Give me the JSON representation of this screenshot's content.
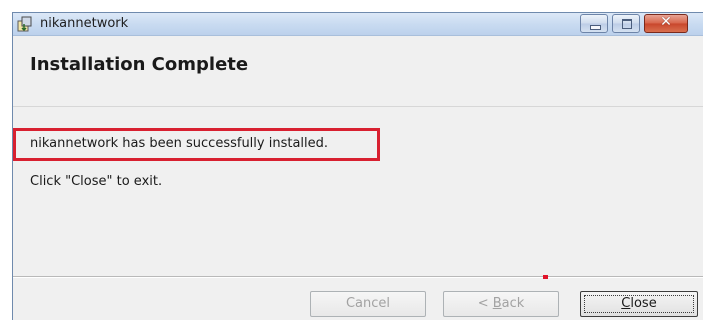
{
  "window": {
    "title": "nikannetwork"
  },
  "titlebar_buttons": {
    "minimize_icon": "minimize-icon",
    "maximize_icon": "maximize-icon",
    "close_icon": "close-icon",
    "close_glyph": "✕"
  },
  "header": {
    "heading": "Installation Complete"
  },
  "body": {
    "success_message": "nikannetwork has been successfully installed.",
    "instruction": "Click \"Close\" to exit."
  },
  "buttons": {
    "cancel": {
      "label": "Cancel",
      "enabled": false
    },
    "back": {
      "prefix": "< ",
      "mnemonic": "B",
      "rest": "ack",
      "enabled": false
    },
    "close": {
      "mnemonic": "C",
      "rest": "lose",
      "enabled": true,
      "focused": true
    }
  },
  "colors": {
    "highlight_border": "#d82030",
    "marker": "#e0142a"
  }
}
